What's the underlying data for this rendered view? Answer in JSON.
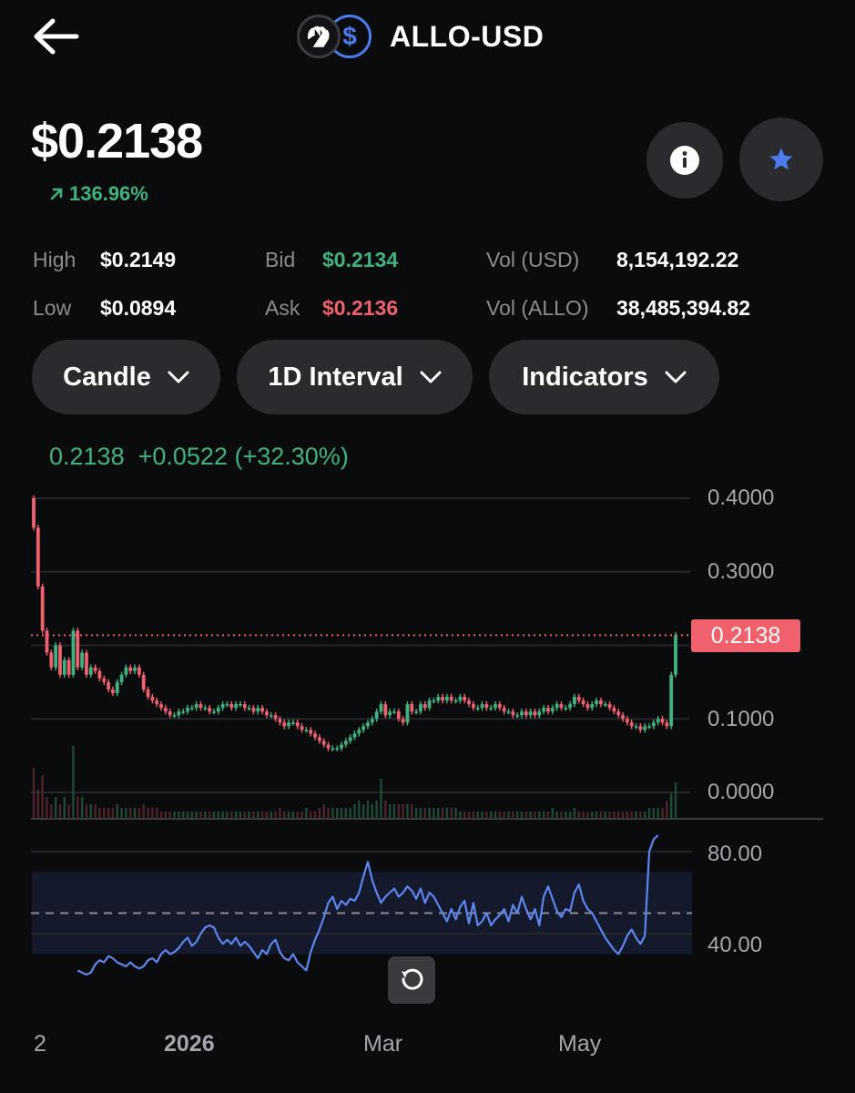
{
  "header": {
    "pair": "ALLO-USD",
    "back_icon": "arrow-left-icon",
    "coin_icon": "allo-hand-logo-icon",
    "quote_icon": "dollar-circle-icon"
  },
  "summary": {
    "price": "$0.2138",
    "change": "136.96%",
    "change_icon": "arrow-up-right-icon",
    "info_icon": "info-icon",
    "favorite_icon": "star-icon"
  },
  "stats": {
    "high_label": "High",
    "high_value": "$0.2149",
    "low_label": "Low",
    "low_value": "$0.0894",
    "bid_label": "Bid",
    "bid_value": "$0.2134",
    "ask_label": "Ask",
    "ask_value": "$0.2136",
    "vol_usd_label": "Vol (USD)",
    "vol_usd_value": "8,154,192.22",
    "vol_allo_label": "Vol (ALLO)",
    "vol_allo_value": "38,485,394.82"
  },
  "controls": {
    "chart_type": "Candle",
    "interval": "1D Interval",
    "indicators": "Indicators",
    "chevron_icon": "chevron-down-icon",
    "reset_icon": "reset-zoom-icon"
  },
  "ohlc_readout": {
    "close": "0.2138",
    "change": "+0.0522",
    "change_pct": "(+32.30%)"
  },
  "colors": {
    "up": "#3fb27f",
    "down": "#f0616d",
    "accent": "#4b7bec",
    "background": "#0a0b0d",
    "button": "#2a2b2e"
  },
  "chart_data": [
    {
      "type": "candlestick",
      "title": "",
      "ylim": [
        0.0,
        0.4
      ],
      "y_ticks": [
        "0.4000",
        "0.3000",
        "0.2000",
        "0.1000",
        "0.0000"
      ],
      "last_price_label": "0.2138",
      "x_ticks": [
        "2",
        "2026",
        "Mar",
        "May"
      ],
      "close_series": [
        0.36,
        0.28,
        0.22,
        0.19,
        0.17,
        0.2,
        0.16,
        0.18,
        0.16,
        0.22,
        0.17,
        0.19,
        0.16,
        0.17,
        0.165,
        0.155,
        0.15,
        0.14,
        0.135,
        0.15,
        0.16,
        0.17,
        0.165,
        0.17,
        0.16,
        0.14,
        0.13,
        0.125,
        0.12,
        0.115,
        0.11,
        0.105,
        0.105,
        0.11,
        0.11,
        0.115,
        0.115,
        0.12,
        0.115,
        0.115,
        0.11,
        0.11,
        0.115,
        0.12,
        0.12,
        0.115,
        0.12,
        0.12,
        0.115,
        0.115,
        0.11,
        0.115,
        0.11,
        0.105,
        0.105,
        0.1,
        0.095,
        0.09,
        0.095,
        0.095,
        0.09,
        0.085,
        0.085,
        0.08,
        0.075,
        0.07,
        0.065,
        0.06,
        0.06,
        0.06,
        0.065,
        0.07,
        0.075,
        0.08,
        0.085,
        0.09,
        0.095,
        0.1,
        0.11,
        0.12,
        0.105,
        0.11,
        0.11,
        0.1,
        0.095,
        0.12,
        0.11,
        0.11,
        0.12,
        0.115,
        0.125,
        0.125,
        0.13,
        0.125,
        0.13,
        0.125,
        0.125,
        0.13,
        0.125,
        0.12,
        0.115,
        0.115,
        0.12,
        0.115,
        0.115,
        0.12,
        0.115,
        0.11,
        0.11,
        0.105,
        0.105,
        0.11,
        0.105,
        0.11,
        0.105,
        0.11,
        0.115,
        0.11,
        0.115,
        0.12,
        0.115,
        0.115,
        0.12,
        0.13,
        0.125,
        0.12,
        0.115,
        0.12,
        0.125,
        0.12,
        0.12,
        0.115,
        0.11,
        0.105,
        0.1,
        0.095,
        0.09,
        0.09,
        0.085,
        0.09,
        0.09,
        0.095,
        0.1,
        0.095,
        0.09,
        0.16,
        0.2138
      ],
      "volume_series": [
        0.7,
        0.4,
        0.6,
        0.3,
        0.2,
        0.3,
        0.2,
        0.3,
        0.2,
        1.0,
        0.3,
        0.3,
        0.2,
        0.2,
        0.2,
        0.15,
        0.15,
        0.15,
        0.15,
        0.2,
        0.15,
        0.15,
        0.15,
        0.15,
        0.15,
        0.2,
        0.15,
        0.15,
        0.15,
        0.1,
        0.1,
        0.1,
        0.1,
        0.1,
        0.1,
        0.1,
        0.1,
        0.1,
        0.1,
        0.1,
        0.1,
        0.1,
        0.1,
        0.1,
        0.1,
        0.1,
        0.1,
        0.1,
        0.1,
        0.1,
        0.1,
        0.1,
        0.1,
        0.1,
        0.1,
        0.1,
        0.15,
        0.1,
        0.1,
        0.1,
        0.1,
        0.1,
        0.15,
        0.1,
        0.1,
        0.15,
        0.2,
        0.15,
        0.15,
        0.15,
        0.15,
        0.15,
        0.15,
        0.2,
        0.25,
        0.2,
        0.25,
        0.2,
        0.25,
        0.55,
        0.25,
        0.2,
        0.2,
        0.2,
        0.2,
        0.2,
        0.2,
        0.15,
        0.15,
        0.15,
        0.15,
        0.15,
        0.15,
        0.15,
        0.15,
        0.15,
        0.15,
        0.1,
        0.1,
        0.1,
        0.1,
        0.1,
        0.1,
        0.1,
        0.1,
        0.1,
        0.1,
        0.1,
        0.1,
        0.1,
        0.1,
        0.1,
        0.1,
        0.1,
        0.1,
        0.1,
        0.1,
        0.1,
        0.15,
        0.1,
        0.1,
        0.1,
        0.1,
        0.15,
        0.1,
        0.1,
        0.1,
        0.1,
        0.1,
        0.1,
        0.1,
        0.1,
        0.1,
        0.1,
        0.1,
        0.1,
        0.1,
        0.1,
        0.1,
        0.1,
        0.15,
        0.15,
        0.15,
        0.15,
        0.25,
        0.35,
        0.5,
        0.8
      ]
    },
    {
      "type": "line",
      "title": "",
      "ylim": [
        0,
        100
      ],
      "y_ticks": [
        "80.00",
        "40.00"
      ],
      "band": [
        30,
        70
      ],
      "midline": 50,
      "values": [
        22,
        21,
        20,
        21,
        25,
        27,
        26,
        29,
        28,
        26,
        25,
        24,
        26,
        24,
        23,
        24,
        27,
        28,
        26,
        30,
        32,
        30,
        31,
        33,
        36,
        38,
        34,
        36,
        40,
        43,
        44,
        43,
        38,
        35,
        37,
        35,
        38,
        34,
        36,
        34,
        31,
        28,
        32,
        30,
        35,
        37,
        31,
        28,
        27,
        30,
        26,
        24,
        22,
        31,
        37,
        42,
        48,
        55,
        58,
        52,
        56,
        54,
        57,
        56,
        60,
        68,
        75,
        66,
        60,
        55,
        58,
        60,
        62,
        58,
        60,
        63,
        61,
        57,
        62,
        55,
        60,
        58,
        54,
        50,
        46,
        52,
        47,
        53,
        56,
        45,
        55,
        44,
        46,
        50,
        44,
        47,
        49,
        52,
        46,
        54,
        50,
        58,
        52,
        47,
        52,
        44,
        58,
        63,
        57,
        51,
        48,
        52,
        51,
        60,
        64,
        56,
        52,
        50,
        46,
        42,
        38,
        35,
        32,
        30,
        34,
        39,
        42,
        38,
        35,
        39,
        80,
        86,
        90
      ],
      "value_start_offset": 10
    }
  ]
}
